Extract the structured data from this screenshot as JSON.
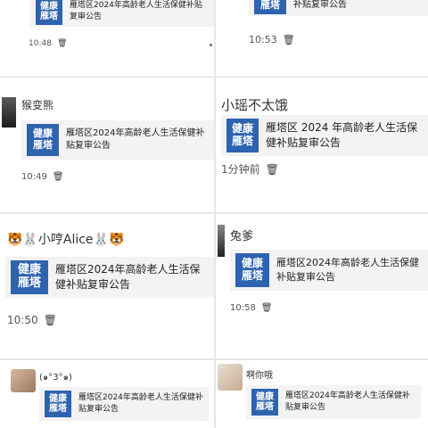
{
  "snippets": [
    {
      "name": "",
      "card_title": "雁塔区2024年高龄老人生活保健补贴复审公告",
      "logo": [
        "健康",
        "雁塔"
      ],
      "time": "10:48"
    },
    {
      "name": "",
      "card_title": "补贴复审公告",
      "logo": [
        "雁塔"
      ],
      "time": "10:53"
    },
    {
      "name": "猴变熊",
      "card_title": "雁塔区2024年高龄老人生活保健补贴复审公告",
      "logo": [
        "健康",
        "雁塔"
      ],
      "time": "10:49"
    },
    {
      "name": "小瑶不太饿",
      "card_title": "雁塔区 2024 年高龄老人生活保健补贴复审公告",
      "logo": [
        "健康",
        "雁塔"
      ],
      "time": "1分钟前"
    },
    {
      "name": "🐯🐰小哼Alice🐰🐯",
      "card_title": "雁塔区2024年高龄老人生活保健补贴复审公告",
      "logo": [
        "健康",
        "雁塔"
      ],
      "time": "10:50"
    },
    {
      "name": "兔爹",
      "card_title": "雁塔区2024年高龄老人生活保健补贴复审公告",
      "logo": [
        "健康",
        "雁塔"
      ],
      "time": "10:58"
    },
    {
      "name": "(๑°3°๑)",
      "card_title": "雁塔区2024年高龄老人生活保健补贴复审公告",
      "logo": [
        "健康",
        "雁塔"
      ],
      "time": ""
    },
    {
      "name": "啊你哦",
      "card_title": "雁塔区2024年高龄老人生活保健补贴复审公告",
      "logo": [
        "健康",
        "雁塔"
      ],
      "time": ""
    }
  ],
  "icons": {
    "delete": "trash-icon",
    "more": "more-dots-icon"
  },
  "colors": {
    "logo_bg": "#2e63b0",
    "card_bg": "#f3f3f3"
  }
}
